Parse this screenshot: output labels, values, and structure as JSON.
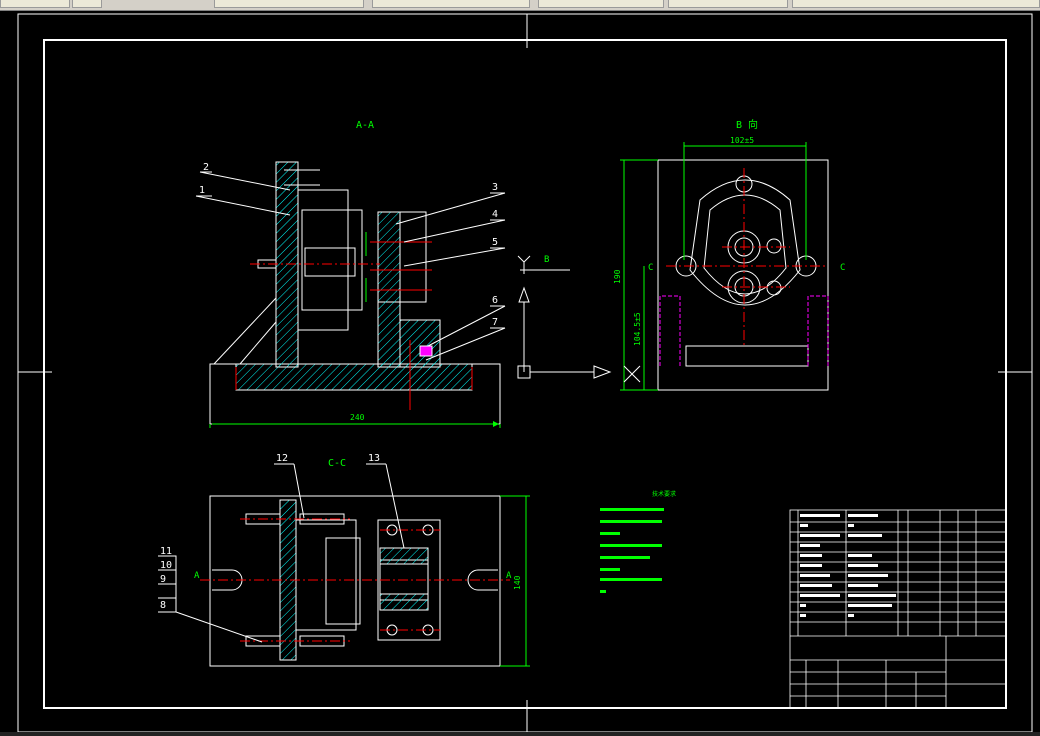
{
  "taskbar": {
    "items": [
      "",
      "",
      "",
      "",
      "",
      "",
      ""
    ]
  },
  "views": {
    "aa": "A-A",
    "bb": "B 向",
    "cc": "C-C"
  },
  "dims": {
    "d240": "240",
    "d190": "190",
    "d140": "140",
    "d102": "102±5",
    "d1045": "104.5±5"
  },
  "section_marks": {
    "a_left": "A",
    "a_right": "A",
    "b": "B",
    "c_left": "C",
    "c_right": "C"
  },
  "balloons": [
    "1",
    "2",
    "3",
    "4",
    "5",
    "6",
    "7",
    "8",
    "9",
    "10",
    "11",
    "12",
    "13"
  ],
  "notes": {
    "title": "技术要求",
    "lines": [
      "",
      "",
      "",
      "",
      "",
      "",
      ""
    ]
  },
  "colors": {
    "frame": "#ffffff",
    "dim": "#00ff00",
    "center": "#ff0000",
    "hidden": "#ff00ff",
    "hatch": "#00ffff",
    "note": "#00ff00"
  }
}
